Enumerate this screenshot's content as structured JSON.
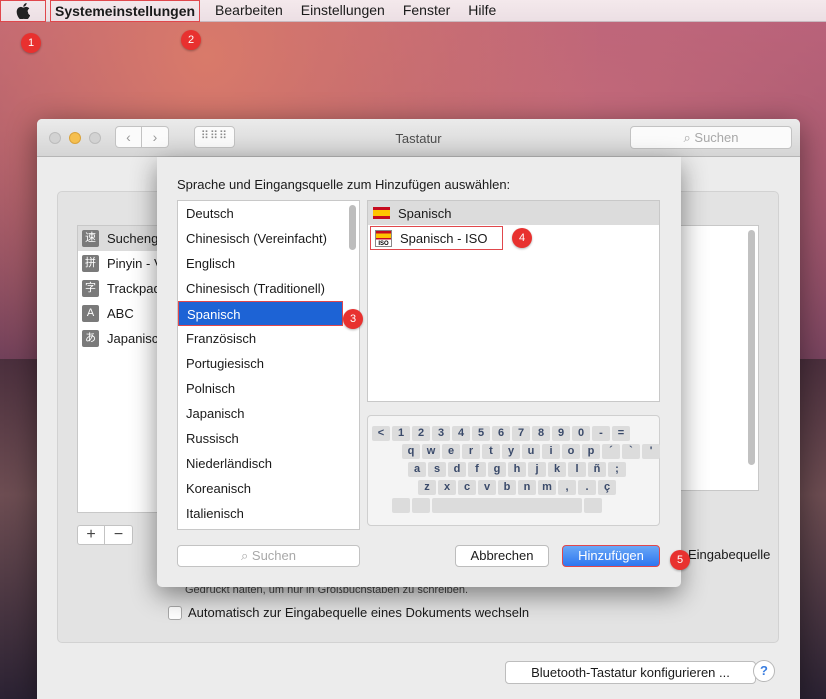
{
  "menubar": {
    "app_name": "Systemeinstellungen",
    "items": [
      "Bearbeiten",
      "Einstellungen",
      "Fenster",
      "Hilfe"
    ]
  },
  "markers": [
    "1",
    "2",
    "3",
    "4",
    "5"
  ],
  "window": {
    "title": "Tastatur",
    "search_placeholder": "Suchen",
    "nav_back": "‹",
    "nav_forward": "›",
    "grid_icon": "grid-icon"
  },
  "input_sources": [
    {
      "icon": "速",
      "label": "Suchengine"
    },
    {
      "icon": "拼",
      "label": "Pinyin - Vereinfacht"
    },
    {
      "icon": "字",
      "label": "Trackpad Handschrift"
    },
    {
      "icon": "A",
      "label": "ABC"
    },
    {
      "icon": "あ",
      "label": "Japanisch"
    }
  ],
  "add_remove": {
    "add": "+",
    "remove": "−"
  },
  "eingabequelle_label": "Eingabequelle",
  "hint_text": "Gedrückt halten, um nur in Großbuchstaben zu schreiben.",
  "auto_switch_label": "Automatisch zur Eingabequelle eines Dokuments wechseln",
  "bluetooth_button": "Bluetooth-Tastatur konfigurieren ...",
  "help_label": "?",
  "sheet": {
    "title": "Sprache und Eingangsquelle zum Hinzufügen auswählen:",
    "languages": [
      "Deutsch",
      "Chinesisch (Vereinfacht)",
      "Englisch",
      "Chinesisch (Traditionell)",
      "Spanisch",
      "Französisch",
      "Portugiesisch",
      "Polnisch",
      "Japanisch",
      "Russisch",
      "Niederländisch",
      "Koreanisch",
      "Italienisch"
    ],
    "selected_language": "Spanisch",
    "source_header": "Spanisch",
    "source_item": "Spanisch - ISO",
    "search_placeholder": "Suchen",
    "cancel_label": "Abbrechen",
    "add_label": "Hinzufügen"
  },
  "keyboard_rows": [
    [
      "<",
      "1",
      "2",
      "3",
      "4",
      "5",
      "6",
      "7",
      "8",
      "9",
      "0",
      "-",
      "="
    ],
    [
      "q",
      "w",
      "e",
      "r",
      "t",
      "y",
      "u",
      "i",
      "o",
      "p",
      "´",
      "`",
      "'"
    ],
    [
      "a",
      "s",
      "d",
      "f",
      "g",
      "h",
      "j",
      "k",
      "l",
      "ñ",
      ";"
    ],
    [
      "z",
      "x",
      "c",
      "v",
      "b",
      "n",
      "m",
      ",",
      ".",
      "ç"
    ]
  ],
  "colors": {
    "accent": "#1d63d5",
    "marker": "#e8312f",
    "highlight_border": "#e0474c"
  }
}
